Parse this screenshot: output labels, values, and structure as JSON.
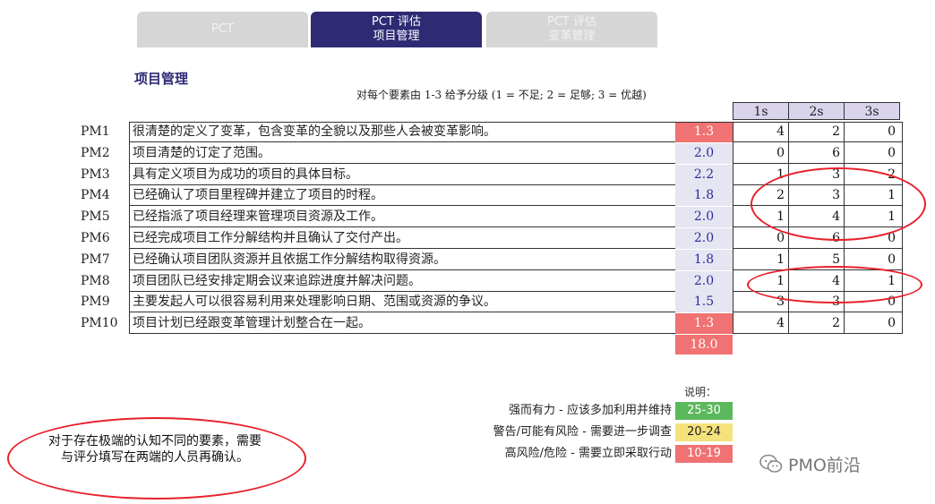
{
  "tabs": [
    {
      "line1": "PCT",
      "line2": ""
    },
    {
      "line1": "PCT 评估",
      "line2": "项目管理"
    },
    {
      "line1": "PCT 评估",
      "line2": "变革管理"
    }
  ],
  "section_title": "项目管理",
  "instruction": "对每个要素由 1-3 给予分级  (1 = 不足; 2 = 足够; 3 = 优越)",
  "columns": [
    "1s",
    "2s",
    "3s"
  ],
  "rows": [
    {
      "code": "PM1",
      "text": "很清楚的定义了变革，包含变革的全貌以及那些人会被变革影响。",
      "score": "1.3",
      "level": "red",
      "c1": "4",
      "c2": "2",
      "c3": "0"
    },
    {
      "code": "PM2",
      "text": "项目清楚的订定了范围。",
      "score": "2.0",
      "level": "blue",
      "c1": "0",
      "c2": "6",
      "c3": "0"
    },
    {
      "code": "PM3",
      "text": "具有定义项目为成功的项目的具体目标。",
      "score": "2.2",
      "level": "blue",
      "c1": "1",
      "c2": "3",
      "c3": "2"
    },
    {
      "code": "PM4",
      "text": "已经确认了项目里程碑并建立了项目的时程。",
      "score": "1.8",
      "level": "blue",
      "c1": "2",
      "c2": "3",
      "c3": "1"
    },
    {
      "code": "PM5",
      "text": "已经指派了项目经理来管理项目资源及工作。",
      "score": "2.0",
      "level": "blue",
      "c1": "1",
      "c2": "4",
      "c3": "1"
    },
    {
      "code": "PM6",
      "text": "已经完成项目工作分解结构并且确认了交付产出。",
      "score": "2.0",
      "level": "blue",
      "c1": "0",
      "c2": "6",
      "c3": "0"
    },
    {
      "code": "PM7",
      "text": "已经确认项目团队资源并且依据工作分解结构取得资源。",
      "score": "1.8",
      "level": "blue",
      "c1": "1",
      "c2": "5",
      "c3": "0"
    },
    {
      "code": "PM8",
      "text": "项目团队已经安排定期会议来追踪进度并解决问题。",
      "score": "2.0",
      "level": "blue",
      "c1": "1",
      "c2": "4",
      "c3": "1"
    },
    {
      "code": "PM9",
      "text": "主要发起人可以很容易利用来处理影响日期、范围或资源的争议。",
      "score": "1.5",
      "level": "blue",
      "c1": "3",
      "c2": "3",
      "c3": "0"
    },
    {
      "code": "PM10",
      "text": "项目计划已经跟变革管理计划整合在一起。",
      "score": "1.3",
      "level": "red",
      "c1": "4",
      "c2": "2",
      "c3": "0"
    }
  ],
  "total": "18.0",
  "legend": {
    "title": "说明：",
    "items": [
      {
        "label": "强而有力 - 应该多加利用并维持",
        "range": "25-30",
        "color": "#5cb85c",
        "text_color": "#ffffff"
      },
      {
        "label": "警告/可能有风险 - 需要进一步调查",
        "range": "20-24",
        "color": "#f5e27a",
        "text_color": "#222222"
      },
      {
        "label": "高风险/危险 - 需要立即采取行动",
        "range": "10-19",
        "color": "#f07272",
        "text_color": "#ffffff"
      }
    ]
  },
  "note": "对于存在极端的认知不同的要素，需要与评分填写在两端的人员再确认。",
  "watermark": "PMO前沿",
  "colors": {
    "accent": "#2e2a74",
    "highlight_red": "#e8202a",
    "score_red": "#f07272",
    "score_blue_bg": "#e6e6f2",
    "header_purple": "#d9d3ec"
  }
}
